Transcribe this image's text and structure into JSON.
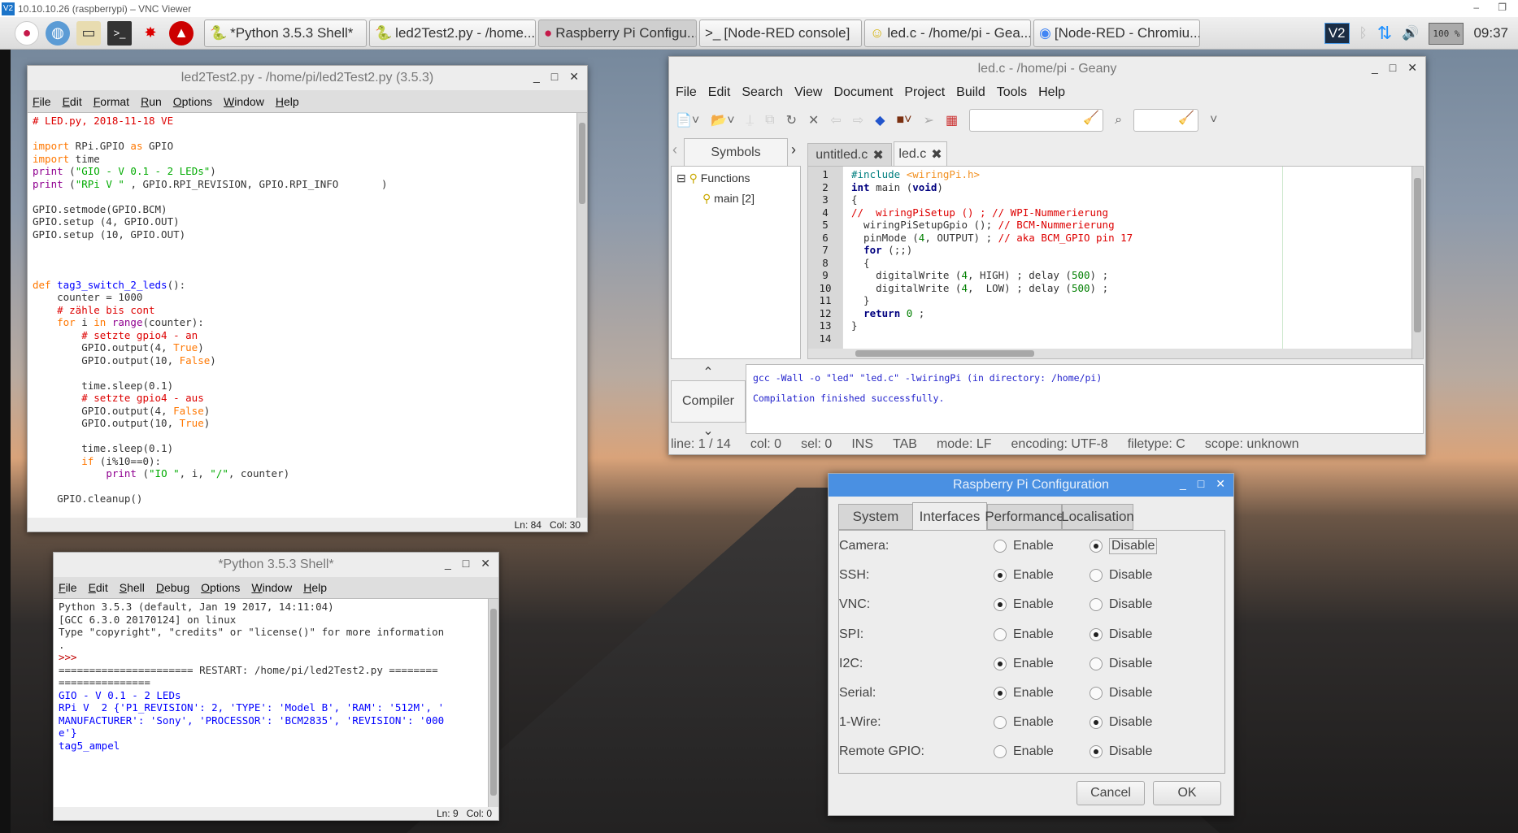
{
  "vnc": {
    "title": "10.10.10.26 (raspberrypi) – VNC Viewer",
    "logo": "V2"
  },
  "taskbar": {
    "launchers": [
      "raspberry-menu-icon",
      "web-browser-icon",
      "file-manager-icon",
      "terminal-icon",
      "mathematica-icon",
      "wolfram-icon"
    ],
    "windows": [
      {
        "label": "*Python 3.5.3 Shell*",
        "icon": "python-icon"
      },
      {
        "label": "led2Test2.py - /home...",
        "icon": "python-icon"
      },
      {
        "label": "Raspberry Pi Configu...",
        "icon": "raspberry-icon"
      },
      {
        "label": "[Node-RED console]",
        "icon": "terminal-icon"
      },
      {
        "label": "led.c - /home/pi - Gea...",
        "icon": "geany-icon"
      },
      {
        "label": "[Node-RED - Chromiu...",
        "icon": "chromium-icon"
      }
    ],
    "tray": {
      "vnc": "V2",
      "cpu": "100 %",
      "clock": "09:37"
    }
  },
  "editor": {
    "title": "led2Test2.py - /home/pi/led2Test2.py (3.5.3)",
    "menu": [
      "File",
      "Edit",
      "Format",
      "Run",
      "Options",
      "Window",
      "Help"
    ],
    "lines": [
      [
        [
          "# LED.py, 2018-11-18 VE",
          "cm"
        ]
      ],
      [],
      [
        [
          "import",
          "kw"
        ],
        [
          " RPi.GPIO ",
          ""
        ],
        [
          "as",
          "kw"
        ],
        [
          " GPIO",
          ""
        ]
      ],
      [
        [
          "import",
          "kw"
        ],
        [
          " time",
          ""
        ]
      ],
      [
        [
          "print",
          "bi"
        ],
        [
          " (",
          ""
        ],
        [
          "\"GIO - V 0.1 - 2 LEDs\"",
          "str"
        ],
        [
          ")",
          ""
        ]
      ],
      [
        [
          "print",
          "bi"
        ],
        [
          " (",
          ""
        ],
        [
          "\"RPi V \"",
          "str"
        ],
        [
          " , GPIO.RPI_REVISION, GPIO.RPI_INFO       )",
          ""
        ]
      ],
      [],
      [
        [
          "GPIO.setmode(GPIO.BCM)",
          ""
        ]
      ],
      [
        [
          "GPIO.setup (4, GPIO.OUT)",
          ""
        ]
      ],
      [
        [
          "GPIO.setup (10, GPIO.OUT)",
          ""
        ]
      ],
      [],
      [],
      [],
      [
        [
          "def",
          "kw"
        ],
        [
          " ",
          ""
        ],
        [
          "tag3_switch_2_leds",
          "df"
        ],
        [
          "():",
          ""
        ]
      ],
      [
        [
          "    counter = 1000",
          ""
        ]
      ],
      [
        [
          "    # zähle bis cont",
          "cm"
        ]
      ],
      [
        [
          "    ",
          ""
        ],
        [
          "for",
          "kw"
        ],
        [
          " i ",
          ""
        ],
        [
          "in",
          "kw"
        ],
        [
          " ",
          ""
        ],
        [
          "range",
          "bi"
        ],
        [
          "(counter):",
          ""
        ]
      ],
      [
        [
          "        # setzte gpio4 - an",
          "cm"
        ]
      ],
      [
        [
          "        GPIO.output(4, ",
          ""
        ],
        [
          "True",
          "kw"
        ],
        [
          ")",
          ""
        ]
      ],
      [
        [
          "        GPIO.output(10, ",
          ""
        ],
        [
          "False",
          "kw"
        ],
        [
          ")",
          ""
        ]
      ],
      [],
      [
        [
          "        time.sleep(0.1)",
          ""
        ]
      ],
      [
        [
          "        # setzte gpio4 - aus",
          "cm"
        ]
      ],
      [
        [
          "        GPIO.output(4, ",
          ""
        ],
        [
          "False",
          "kw"
        ],
        [
          ")",
          ""
        ]
      ],
      [
        [
          "        GPIO.output(10, ",
          ""
        ],
        [
          "True",
          "kw"
        ],
        [
          ")",
          ""
        ]
      ],
      [],
      [
        [
          "        time.sleep(0.1)",
          ""
        ]
      ],
      [
        [
          "        ",
          ""
        ],
        [
          "if",
          "kw"
        ],
        [
          " (i%10==0):",
          ""
        ]
      ],
      [
        [
          "            ",
          ""
        ],
        [
          "print",
          "bi"
        ],
        [
          " (",
          ""
        ],
        [
          "\"IO \"",
          "str"
        ],
        [
          ", i, ",
          ""
        ],
        [
          "\"/\"",
          "str"
        ],
        [
          ", counter)",
          ""
        ]
      ],
      [],
      [
        [
          "    GPIO.cleanup()",
          ""
        ]
      ]
    ],
    "status": {
      "ln": "Ln: 84",
      "col": "Col: 30"
    }
  },
  "shell": {
    "title": "*Python 3.5.3 Shell*",
    "menu": [
      "File",
      "Edit",
      "Shell",
      "Debug",
      "Options",
      "Window",
      "Help"
    ],
    "lines": [
      [
        [
          "Python 3.5.3 (default, Jan 19 2017, 14:11:04)",
          ""
        ]
      ],
      [
        [
          "[GCC 6.3.0 20170124] on linux",
          ""
        ]
      ],
      [
        [
          "Type \"copyright\", \"credits\" or \"license()\" for more information",
          ""
        ]
      ],
      [
        [
          ".",
          ""
        ]
      ],
      [
        [
          ">>>",
          "pr"
        ]
      ],
      [
        [
          "====================== RESTART: /home/pi/led2Test2.py ========",
          ""
        ]
      ],
      [
        [
          "===============",
          ""
        ]
      ],
      [
        [
          "GIO - V 0.1 - 2 LEDs",
          "out"
        ]
      ],
      [
        [
          "RPi V  2 {'P1_REVISION': 2, 'TYPE': 'Model B', 'RAM': '512M', '",
          "out"
        ]
      ],
      [
        [
          "MANUFACTURER': 'Sony', 'PROCESSOR': 'BCM2835', 'REVISION': '000",
          "out"
        ]
      ],
      [
        [
          "e'}",
          "out"
        ]
      ],
      [
        [
          "tag5_ampel",
          "out"
        ]
      ]
    ],
    "status": {
      "ln": "Ln: 9",
      "col": "Col: 0"
    }
  },
  "geany": {
    "title": "led.c - /home/pi - Geany",
    "menu": [
      "File",
      "Edit",
      "Search",
      "View",
      "Document",
      "Project",
      "Build",
      "Tools",
      "Help"
    ],
    "sidebar_tab": "Symbols",
    "symbols": {
      "group": "Functions",
      "item": "main [2]"
    },
    "tabs": [
      {
        "label": "untitled.c",
        "active": false
      },
      {
        "label": "led.c",
        "active": true
      }
    ],
    "lines": [
      [
        [
          "#include ",
          "gpp"
        ],
        [
          "<wiringPi.h>",
          "gp"
        ]
      ],
      [
        [
          "int",
          "gk"
        ],
        [
          " main (",
          ""
        ],
        [
          "void",
          "gk"
        ],
        [
          ")",
          ""
        ]
      ],
      [
        [
          "{",
          ""
        ]
      ],
      [
        [
          "//  wiringPiSetup () ; // WPI-Nummerierung",
          "gc"
        ]
      ],
      [
        [
          "  wiringPiSetupGpio (); ",
          ""
        ],
        [
          "// BCM-Nummerierung",
          "gc"
        ]
      ],
      [
        [
          "  pinMode (",
          ""
        ],
        [
          "4",
          "gn"
        ],
        [
          ", OUTPUT) ; ",
          ""
        ],
        [
          "// aka BCM_GPIO pin 17",
          "gc"
        ]
      ],
      [
        [
          "  ",
          ""
        ],
        [
          "for",
          "gk"
        ],
        [
          " (;;)",
          ""
        ]
      ],
      [
        [
          "  {",
          ""
        ]
      ],
      [
        [
          "    digitalWrite (",
          ""
        ],
        [
          "4",
          "gn"
        ],
        [
          ", HIGH) ; delay (",
          ""
        ],
        [
          "500",
          "gn"
        ],
        [
          ") ;",
          ""
        ]
      ],
      [
        [
          "    digitalWrite (",
          ""
        ],
        [
          "4",
          "gn"
        ],
        [
          ",  LOW) ; delay (",
          ""
        ],
        [
          "500",
          "gn"
        ],
        [
          ") ;",
          ""
        ]
      ],
      [
        [
          "  }",
          ""
        ]
      ],
      [
        [
          "  ",
          ""
        ],
        [
          "return",
          "gk"
        ],
        [
          " ",
          ""
        ],
        [
          "0",
          "gn"
        ],
        [
          " ;",
          ""
        ]
      ],
      [
        [
          "}",
          ""
        ]
      ],
      []
    ],
    "msg_tab": "Compiler",
    "compiler": [
      "gcc -Wall -o \"led\" \"led.c\" -lwiringPi (in directory: /home/pi)",
      "Compilation finished successfully."
    ],
    "status": [
      "line: 1 / 14",
      "col: 0",
      "sel: 0",
      "INS",
      "TAB",
      "mode: LF",
      "encoding: UTF-8",
      "filetype: C",
      "scope: unknown"
    ]
  },
  "config": {
    "title": "Raspberry Pi Configuration",
    "tabs": [
      "System",
      "Interfaces",
      "Performance",
      "Localisation"
    ],
    "active_tab": "Interfaces",
    "enable_label": "Enable",
    "disable_label": "Disable",
    "rows": [
      {
        "label": "Camera:",
        "enabled": false
      },
      {
        "label": "SSH:",
        "enabled": true
      },
      {
        "label": "VNC:",
        "enabled": true
      },
      {
        "label": "SPI:",
        "enabled": false
      },
      {
        "label": "I2C:",
        "enabled": true
      },
      {
        "label": "Serial:",
        "enabled": true
      },
      {
        "label": "1-Wire:",
        "enabled": false
      },
      {
        "label": "Remote GPIO:",
        "enabled": false
      }
    ],
    "cancel": "Cancel",
    "ok": "OK"
  }
}
